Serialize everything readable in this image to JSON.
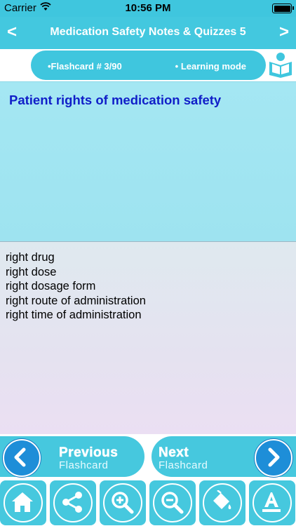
{
  "status_bar": {
    "carrier": "Carrier",
    "time": "10:56 PM"
  },
  "header": {
    "title": "Medication Safety Notes & Quizzes 5",
    "back_label": "<",
    "forward_label": ">"
  },
  "info": {
    "flashcard_label": "•Flashcard #  3/90",
    "mode_label": "• Learning mode"
  },
  "card": {
    "question": "Patient rights of medication safety",
    "answers": [
      "right drug",
      "right dose",
      "right dosage form",
      "right route of administration",
      "right time of administration"
    ]
  },
  "navigation": {
    "previous": {
      "big": "Previous",
      "small": "Flashcard"
    },
    "next": {
      "big": "Next",
      "small": "Flashcard"
    }
  },
  "toolbar": {
    "icons": [
      "home-icon",
      "share-icon",
      "zoom-in-icon",
      "zoom-out-icon",
      "paint-bucket-icon",
      "font-icon"
    ]
  },
  "colors": {
    "accent": "#43c8df",
    "question_text": "#101ec8",
    "nav_circle": "#1e8ed8"
  }
}
